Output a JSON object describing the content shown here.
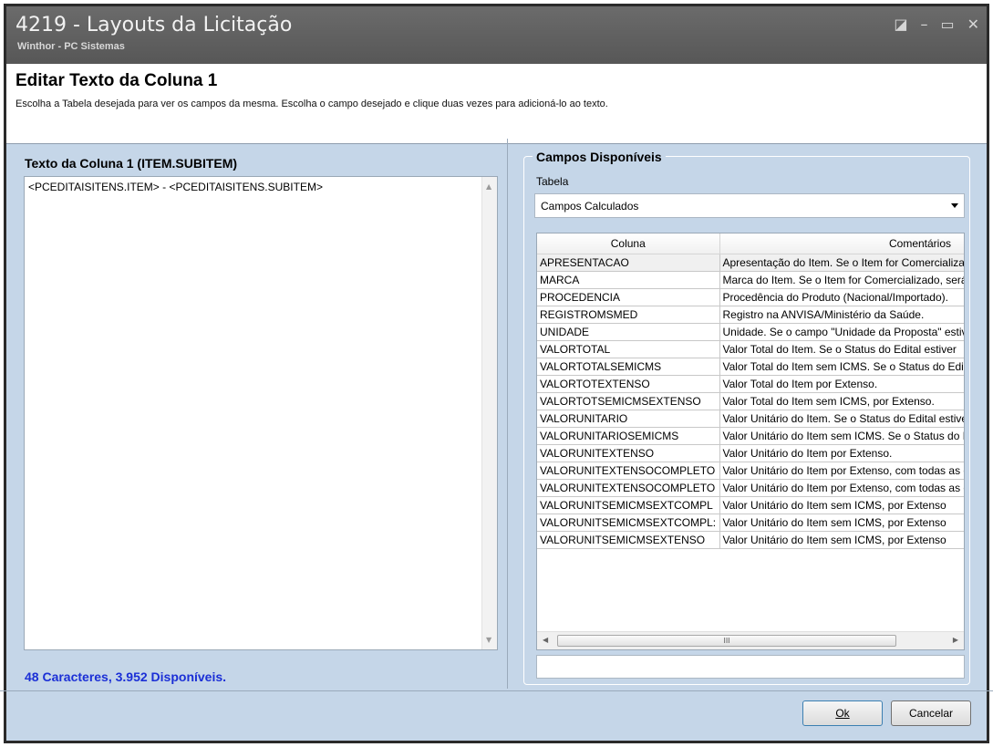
{
  "window": {
    "title": "4219 - Layouts da Licitação",
    "subtitle": "Winthor - PC Sistemas",
    "controls": {
      "restore": "◪",
      "minimize": "–",
      "maximize": "▭",
      "close": "✕"
    }
  },
  "header": {
    "title": "Editar Texto da Coluna 1",
    "description": "Escolha a Tabela desejada para ver os campos da mesma. Escolha o campo desejado e clique duas vezes para adicioná-lo ao texto."
  },
  "left": {
    "title": "Texto da Coluna 1 (ITEM.SUBITEM)",
    "text": "<PCEDITAISITENS.ITEM> - <PCEDITAISITENS.SUBITEM>",
    "chars_info": "48 Caracteres, 3.952 Disponíveis."
  },
  "right": {
    "group_title": "Campos Disponíveis",
    "table_label": "Tabela",
    "table_selected": "Campos Calculados",
    "grid": {
      "headers": [
        "Coluna",
        "Comentários"
      ],
      "rows": [
        [
          "APRESENTACAO",
          "Apresentação do Item. Se o Item for Comercializado"
        ],
        [
          "MARCA",
          "Marca do Item. Se o Item for Comercializado, será"
        ],
        [
          "PROCEDENCIA",
          "Procedência do Produto (Nacional/Importado)."
        ],
        [
          "REGISTROMSMED",
          "Registro na ANVISA/Ministério da Saúde."
        ],
        [
          "UNIDADE",
          "Unidade. Se o campo \"Unidade da Proposta\" estiver"
        ],
        [
          "VALORTOTAL",
          "Valor Total do Item. Se o Status do Edital estiver"
        ],
        [
          "VALORTOTALSEMICMS",
          "Valor Total do Item sem ICMS. Se o Status do Edital"
        ],
        [
          "VALORTOTEXTENSO",
          "Valor Total do Item por Extenso."
        ],
        [
          "VALORTOTSEMICMSEXTENSO",
          "Valor Total do Item sem ICMS, por Extenso."
        ],
        [
          "VALORUNITARIO",
          "Valor Unitário do Item. Se o Status do Edital estiver"
        ],
        [
          "VALORUNITARIOSEMICMS",
          "Valor Unitário do Item sem ICMS. Se o Status do Edital"
        ],
        [
          "VALORUNITEXTENSO",
          "Valor Unitário do Item por Extenso."
        ],
        [
          "VALORUNITEXTENSOCOMPLETO",
          "Valor Unitário do Item por Extenso, com todas as casas"
        ],
        [
          "VALORUNITEXTENSOCOMPLETO",
          "Valor Unitário do Item por Extenso, com todas as casas"
        ],
        [
          "VALORUNITSEMICMSEXTCOMPL",
          "Valor Unitário do Item sem ICMS, por Extenso"
        ],
        [
          "VALORUNITSEMICMSEXTCOMPL:",
          "Valor Unitário do Item sem ICMS, por Extenso"
        ],
        [
          "VALORUNITSEMICMSEXTENSO",
          "Valor Unitário do Item sem ICMS, por Extenso"
        ]
      ]
    },
    "scroll_thumb_glyph": "III"
  },
  "buttons": {
    "ok": "Ok",
    "cancel": "Cancelar"
  }
}
